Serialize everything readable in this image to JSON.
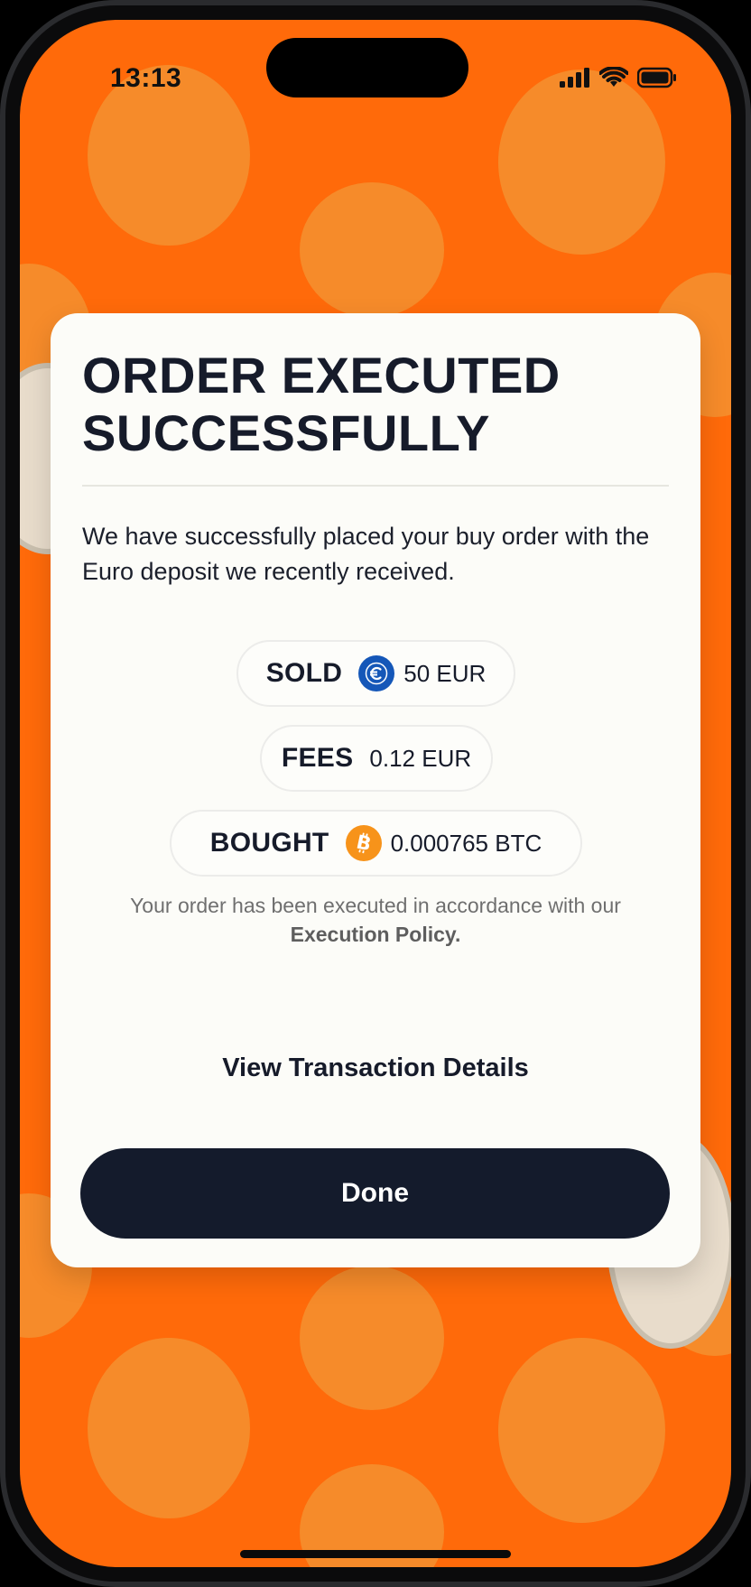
{
  "status_bar": {
    "time": "13:13",
    "icons": [
      "cellular-signal-icon",
      "wifi-icon",
      "battery-icon"
    ]
  },
  "card": {
    "title_line1": "ORDER EXECUTED",
    "title_line2": "SUCCESSFULLY",
    "message": "We have successfully placed your buy order with the Euro deposit we recently received.",
    "sold": {
      "label": "SOLD",
      "icon": "euro-icon",
      "value": "50 EUR"
    },
    "fees": {
      "label": "FEES",
      "value": "0.12 EUR"
    },
    "bought": {
      "label": "BOUGHT",
      "icon": "bitcoin-icon",
      "value": "0.000765 BTC"
    },
    "policy_text": "Your order has been executed in accordance with our ",
    "policy_link": "Execution Policy.",
    "view_details": "View Transaction Details",
    "done": "Done"
  },
  "colors": {
    "background_orange": "#ff6a0a",
    "blob_orange": "#f58d2c",
    "card_bg": "#fcfcf8",
    "navy": "#141b2c",
    "euro_blue": "#1557b8",
    "bitcoin_orange": "#f7931a"
  }
}
